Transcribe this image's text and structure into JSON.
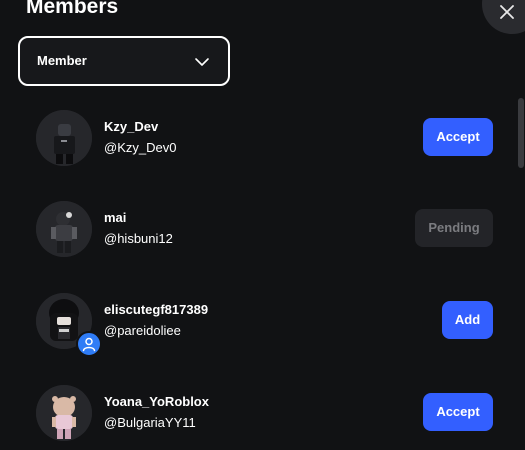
{
  "header": {
    "title": "Members"
  },
  "filter": {
    "selected": "Member"
  },
  "members": [
    {
      "display_name": "Kzy_Dev",
      "username": "@Kzy_Dev0",
      "action": "Accept"
    },
    {
      "display_name": "mai",
      "username": "@hisbuni12",
      "action": "Pending"
    },
    {
      "display_name": "eliscutegf817389",
      "username": "@pareidoliee",
      "action": "Add"
    },
    {
      "display_name": "Yoana_YoRoblox",
      "username": "@BulgariaYY11",
      "action": "Accept"
    }
  ],
  "colors": {
    "background": "#111214",
    "primary_button": "#335fff",
    "disabled_button": "#232428",
    "badge": "#2f7cf6"
  }
}
